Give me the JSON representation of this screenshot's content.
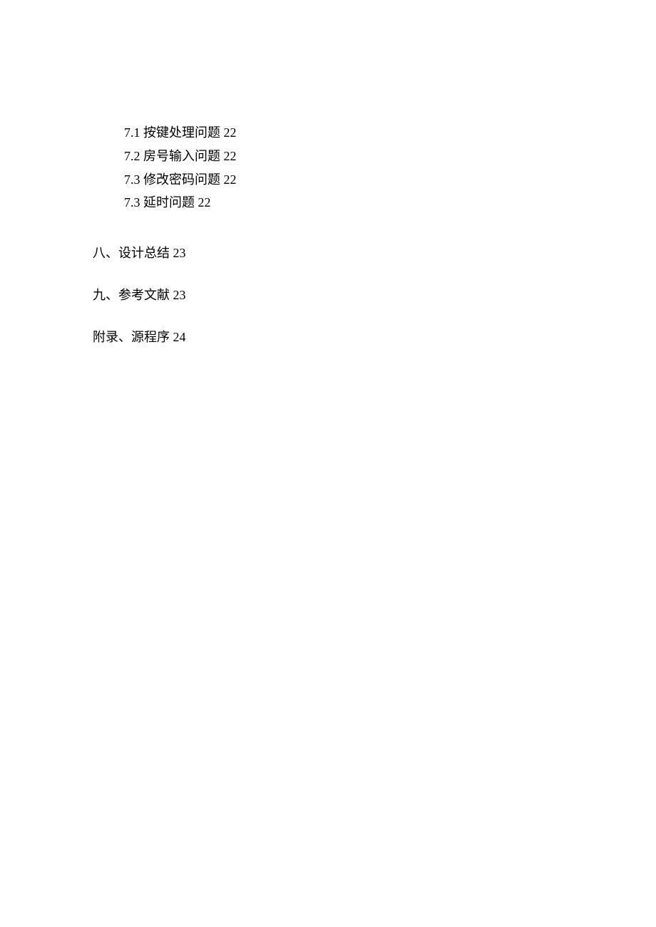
{
  "toc": {
    "subItems": [
      {
        "text": "7.1 按键处理问题 22"
      },
      {
        "text": "7.2 房号输入问题 22"
      },
      {
        "text": "7.3 修改密码问题 22"
      },
      {
        "text": "7.3 延时问题 22"
      }
    ],
    "mainItems": [
      {
        "text": "八、设计总结 23"
      },
      {
        "text": "九、参考文献 23"
      },
      {
        "text": "附录、源程序 24"
      }
    ]
  }
}
